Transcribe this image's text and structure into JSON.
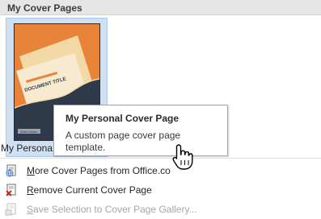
{
  "section": {
    "title": "My Cover Pages"
  },
  "gallery": {
    "tile_label": "My Persona",
    "thumbnail": {
      "doc_title": "DOCUMENT TITLE",
      "footer_text": "Author Name"
    }
  },
  "tooltip": {
    "title": "My Personal Cover Page",
    "body": "A custom page cover page template."
  },
  "menu": {
    "items": [
      {
        "label_pre": "",
        "accel": "M",
        "label_post": "ore Cover Pages from Office.co",
        "icon": "globe-document-icon",
        "enabled": true
      },
      {
        "label_pre": "",
        "accel": "R",
        "label_post": "emove Current Cover Page",
        "icon": "remove-page-icon",
        "enabled": true
      },
      {
        "label_pre": "",
        "accel": "S",
        "label_post": "ave Selection to Cover Page Gallery...",
        "icon": "save-selection-icon",
        "enabled": false
      }
    ]
  },
  "colors": {
    "cover_orange": "#e8833a",
    "cover_navy": "#2e3a4a",
    "cover_paper": "#f5e6c8",
    "tile_selected": "#cfe0f3",
    "remove_red": "#c42b1c"
  }
}
